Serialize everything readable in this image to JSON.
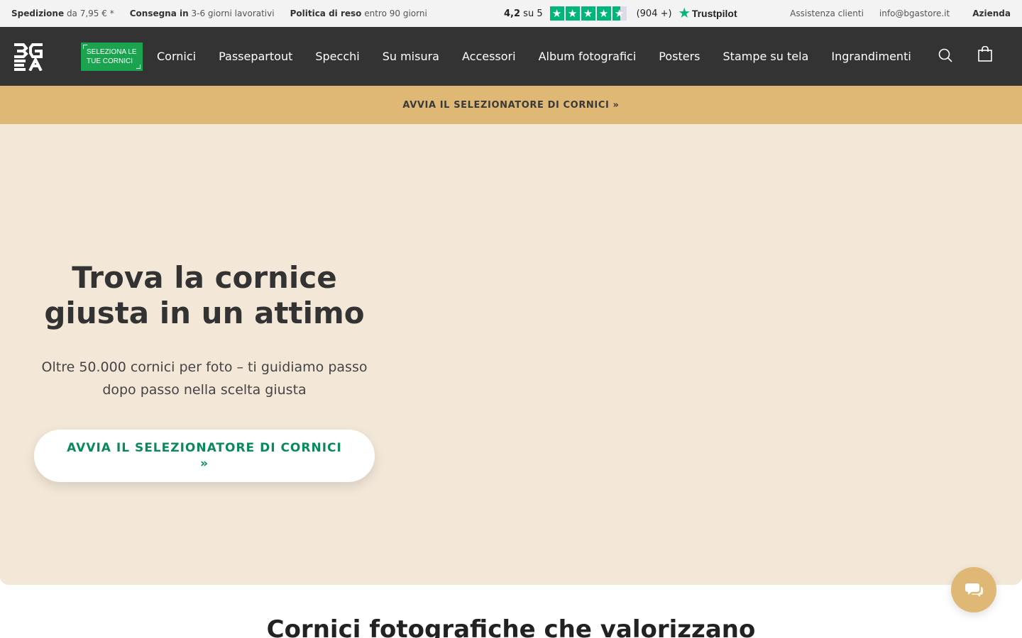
{
  "topbar": {
    "shipping_label": "Spedizione",
    "shipping_value": "da 7,95 € *",
    "delivery_label": "Consegna in",
    "delivery_value": "3-6 giorni lavorativi",
    "returns_label": "Politica di reso",
    "returns_value": "entro 90 giorni",
    "rating_score": "4,2",
    "rating_suffix": "su 5",
    "rating_count": "(904 +)",
    "trustpilot_label": "Trustpilot",
    "star_rating": 4.2,
    "links": [
      "Assistenza clienti",
      "info@bgastore.it",
      "Azienda"
    ]
  },
  "nav": {
    "logo_text": "BGA",
    "selector_badge": "SELEZIONA LE TUE CORNICI",
    "items": [
      "Cornici",
      "Passepartout",
      "Specchi",
      "Su misura",
      "Accessori",
      "Album fotografici",
      "Posters",
      "Stampe su tela",
      "Ingrandimenti"
    ],
    "icons": [
      "search-icon",
      "shopping-bag-icon"
    ]
  },
  "banner": {
    "text": "AVVIA IL SELEZIONATORE DI CORNICI »"
  },
  "hero": {
    "title": "Trova la cornice giusta in un attimo",
    "subtitle": "Oltre 50.000 cornici per foto – ti guidiamo passo dopo passo nella scelta giusta",
    "cta": "AVVIA IL SELEZIONATORE DI CORNICI »"
  },
  "section": {
    "title": "Cornici fotografiche che valorizzano"
  },
  "chat": {
    "icon": "chat-bubbles-icon"
  },
  "colors": {
    "nav_bg": "#333333",
    "banner_bg": "#dfb875",
    "hero_bg": "#f3e8d8",
    "badge_green": "#1ba34f",
    "cta_green": "#0a8a5c",
    "trustpilot_green": "#00b67a"
  }
}
